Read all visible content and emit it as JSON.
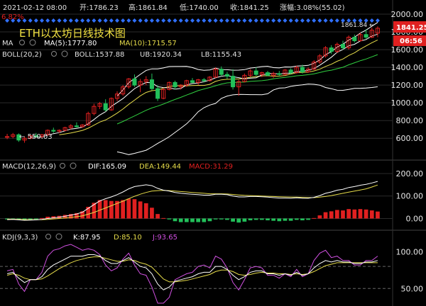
{
  "header": {
    "date_label": "2021-02-12 08:00",
    "open_label": "开:1786.23",
    "high_label": "高:1861.84",
    "low_label": "低:1740.00",
    "close_label": "收:1841.25",
    "change_label": "涨幅:3.08%(55.02)",
    "left_pct": "6.82%"
  },
  "title": "ETH以太坊日线技术图",
  "price_tag": "1841.25",
  "countdown_tag": "06:56",
  "peak_label": "1861.84",
  "low_label": "550.03",
  "ma_panel": {
    "name": "MA",
    "ma5": "MA(5):1777.80",
    "ma10": "MA(10):1715.57"
  },
  "boll_panel": {
    "name": "BOLL(20,2)",
    "boll": "BOLL:1537.88",
    "ub": "UB:1920.34",
    "lb": "LB:1155.43"
  },
  "macd_panel": {
    "name": "MACD(12,26,9)",
    "dif": "DIF:165.09",
    "dea": "DEA:149.44",
    "macd": "MACD:31.29"
  },
  "kdj_panel": {
    "name": "KDJ(9,3,3)",
    "k": "K:87.95",
    "d": "D:85.10",
    "j": "J:93.65"
  },
  "colors": {
    "up": "#e02020",
    "down": "#22c05a",
    "ma5": "#ffffff",
    "ma10": "#e6dc4a",
    "ma20": "#30d040",
    "band": "#ffffff",
    "dif": "#ffffff",
    "dea": "#e6dc4a",
    "kdj_k": "#ffffff",
    "kdj_d": "#e6dc4a",
    "kdj_j": "#d050e0",
    "diamond": "#3070ff",
    "price_tag_bg": "#e02020",
    "title": "#f0e040"
  },
  "chart_data": [
    {
      "type": "candlestick",
      "title": "ETH以太坊日线技术图",
      "ylim": [
        450,
        2000
      ],
      "yticks": [
        2000,
        1800,
        1600,
        1400,
        1200,
        1000,
        800,
        600
      ],
      "series_order": "oldest to newest, daily",
      "ohlc": [
        [
          610,
          650,
          590,
          620
        ],
        [
          620,
          660,
          600,
          640
        ],
        [
          640,
          655,
          560,
          580
        ],
        [
          580,
          620,
          550,
          600
        ],
        [
          600,
          640,
          590,
          630
        ],
        [
          630,
          660,
          610,
          620
        ],
        [
          620,
          650,
          600,
          640
        ],
        [
          640,
          700,
          630,
          690
        ],
        [
          690,
          720,
          660,
          680
        ],
        [
          680,
          700,
          660,
          690
        ],
        [
          690,
          730,
          680,
          720
        ],
        [
          720,
          760,
          700,
          740
        ],
        [
          740,
          780,
          720,
          730
        ],
        [
          730,
          760,
          720,
          750
        ],
        [
          750,
          900,
          740,
          880
        ],
        [
          880,
          990,
          860,
          960
        ],
        [
          960,
          1010,
          930,
          990
        ],
        [
          990,
          1040,
          900,
          920
        ],
        [
          920,
          1060,
          910,
          1050
        ],
        [
          1050,
          1130,
          1020,
          1100
        ],
        [
          1100,
          1200,
          1080,
          1180
        ],
        [
          1180,
          1280,
          1160,
          1270
        ],
        [
          1270,
          1320,
          1180,
          1200
        ],
        [
          1200,
          1270,
          1120,
          1240
        ],
        [
          1240,
          1300,
          1200,
          1260
        ],
        [
          1260,
          1330,
          1140,
          1160
        ],
        [
          1160,
          1200,
          1020,
          1050
        ],
        [
          1050,
          1170,
          1040,
          1150
        ],
        [
          1150,
          1240,
          1140,
          1230
        ],
        [
          1230,
          1250,
          1150,
          1180
        ],
        [
          1180,
          1210,
          1150,
          1200
        ],
        [
          1200,
          1260,
          1180,
          1250
        ],
        [
          1250,
          1280,
          1220,
          1230
        ],
        [
          1230,
          1270,
          1200,
          1260
        ],
        [
          1260,
          1280,
          1230,
          1250
        ],
        [
          1250,
          1300,
          1240,
          1290
        ],
        [
          1290,
          1400,
          1280,
          1380
        ],
        [
          1380,
          1410,
          1300,
          1320
        ],
        [
          1320,
          1350,
          1270,
          1300
        ],
        [
          1300,
          1380,
          1150,
          1180
        ],
        [
          1180,
          1260,
          1080,
          1240
        ],
        [
          1240,
          1330,
          1230,
          1310
        ],
        [
          1310,
          1380,
          1290,
          1360
        ],
        [
          1360,
          1400,
          1300,
          1320
        ],
        [
          1320,
          1350,
          1290,
          1340
        ],
        [
          1340,
          1360,
          1300,
          1310
        ],
        [
          1310,
          1350,
          1280,
          1330
        ],
        [
          1330,
          1360,
          1300,
          1320
        ],
        [
          1320,
          1380,
          1310,
          1370
        ],
        [
          1370,
          1390,
          1320,
          1340
        ],
        [
          1340,
          1420,
          1330,
          1400
        ],
        [
          1400,
          1430,
          1330,
          1350
        ],
        [
          1350,
          1400,
          1340,
          1380
        ],
        [
          1380,
          1480,
          1370,
          1460
        ],
        [
          1460,
          1550,
          1440,
          1530
        ],
        [
          1530,
          1640,
          1510,
          1620
        ],
        [
          1620,
          1650,
          1550,
          1580
        ],
        [
          1580,
          1680,
          1560,
          1660
        ],
        [
          1660,
          1700,
          1600,
          1620
        ],
        [
          1620,
          1760,
          1600,
          1740
        ],
        [
          1740,
          1770,
          1680,
          1700
        ],
        [
          1700,
          1790,
          1690,
          1770
        ],
        [
          1770,
          1830,
          1720,
          1740
        ],
        [
          1740,
          1850,
          1730,
          1820
        ],
        [
          1786,
          1862,
          1740,
          1841
        ]
      ],
      "ma5_last": 1777.8,
      "ma10_last": 1715.57,
      "boll_last": {
        "mid": 1537.88,
        "ub": 1920.34,
        "lb": 1155.43
      }
    },
    {
      "type": "bar",
      "title": "MACD(12,26,9)",
      "ylim": [
        -30,
        200
      ],
      "yticks": [
        200,
        100,
        0
      ],
      "dif_last": 165.09,
      "dea_last": 149.44,
      "macd_last": 31.29,
      "dif": [
        -5,
        -4,
        -6,
        -8,
        -7,
        -6,
        -4,
        0,
        3,
        6,
        10,
        15,
        20,
        28,
        45,
        62,
        78,
        88,
        96,
        106,
        118,
        132,
        142,
        146,
        150,
        146,
        134,
        126,
        122,
        116,
        112,
        110,
        108,
        106,
        104,
        104,
        108,
        108,
        106,
        100,
        96,
        96,
        98,
        98,
        97,
        95,
        93,
        91,
        91,
        90,
        92,
        90,
        90,
        94,
        102,
        112,
        118,
        126,
        130,
        138,
        142,
        148,
        152,
        158,
        165
      ],
      "dea": [
        -3,
        -3,
        -4,
        -5,
        -5,
        -5,
        -5,
        -4,
        -2,
        0,
        2,
        5,
        8,
        12,
        19,
        27,
        37,
        47,
        57,
        67,
        77,
        88,
        99,
        108,
        116,
        122,
        124,
        125,
        124,
        122,
        120,
        118,
        116,
        114,
        112,
        110,
        110,
        110,
        109,
        107,
        105,
        103,
        102,
        101,
        100,
        99,
        98,
        97,
        96,
        95,
        95,
        94,
        93,
        93,
        95,
        98,
        102,
        107,
        112,
        117,
        122,
        127,
        132,
        140,
        149
      ],
      "macd": [
        -4,
        -2,
        -4,
        -6,
        -4,
        -2,
        2,
        8,
        10,
        12,
        16,
        20,
        24,
        32,
        52,
        70,
        82,
        82,
        78,
        78,
        82,
        88,
        86,
        76,
        68,
        48,
        20,
        2,
        -4,
        -12,
        -16,
        -16,
        -16,
        -16,
        -16,
        -12,
        -4,
        -4,
        -6,
        -14,
        -18,
        -14,
        -8,
        -6,
        -6,
        -8,
        -10,
        -12,
        -10,
        -10,
        -6,
        -8,
        -6,
        2,
        14,
        28,
        32,
        38,
        36,
        42,
        40,
        42,
        40,
        36,
        31
      ]
    },
    {
      "type": "line",
      "title": "KDJ(9,3,3)",
      "ylim": [
        30,
        110
      ],
      "yticks": [
        100,
        50
      ],
      "k_last": 87.95,
      "d_last": 85.1,
      "j_last": 93.65,
      "k": [
        70,
        72,
        64,
        58,
        62,
        62,
        66,
        76,
        82,
        86,
        90,
        94,
        94,
        94,
        96,
        96,
        94,
        88,
        84,
        84,
        88,
        92,
        86,
        80,
        78,
        70,
        56,
        48,
        52,
        60,
        62,
        64,
        66,
        70,
        72,
        72,
        80,
        80,
        76,
        68,
        62,
        66,
        72,
        74,
        74,
        70,
        70,
        68,
        70,
        68,
        72,
        68,
        70,
        78,
        84,
        88,
        86,
        88,
        86,
        86,
        84,
        84,
        86,
        86,
        88
      ],
      "d": [
        68,
        70,
        68,
        64,
        62,
        62,
        63,
        67,
        72,
        77,
        81,
        85,
        88,
        90,
        92,
        93,
        93,
        91,
        89,
        87,
        87,
        89,
        88,
        85,
        83,
        79,
        71,
        63,
        59,
        59,
        60,
        61,
        63,
        65,
        67,
        69,
        73,
        75,
        75,
        73,
        69,
        68,
        69,
        71,
        72,
        71,
        71,
        70,
        70,
        69,
        70,
        69,
        70,
        73,
        77,
        81,
        83,
        85,
        85,
        85,
        85,
        85,
        85,
        85,
        85
      ],
      "j": [
        74,
        76,
        56,
        46,
        62,
        62,
        72,
        94,
        102,
        104,
        108,
        112,
        106,
        102,
        104,
        102,
        96,
        82,
        74,
        78,
        90,
        98,
        82,
        70,
        68,
        52,
        26,
        18,
        38,
        62,
        66,
        70,
        72,
        80,
        82,
        78,
        94,
        90,
        78,
        58,
        48,
        62,
        78,
        80,
        78,
        68,
        68,
        64,
        70,
        66,
        76,
        66,
        70,
        88,
        98,
        102,
        92,
        94,
        88,
        88,
        82,
        82,
        88,
        88,
        94
      ]
    }
  ]
}
